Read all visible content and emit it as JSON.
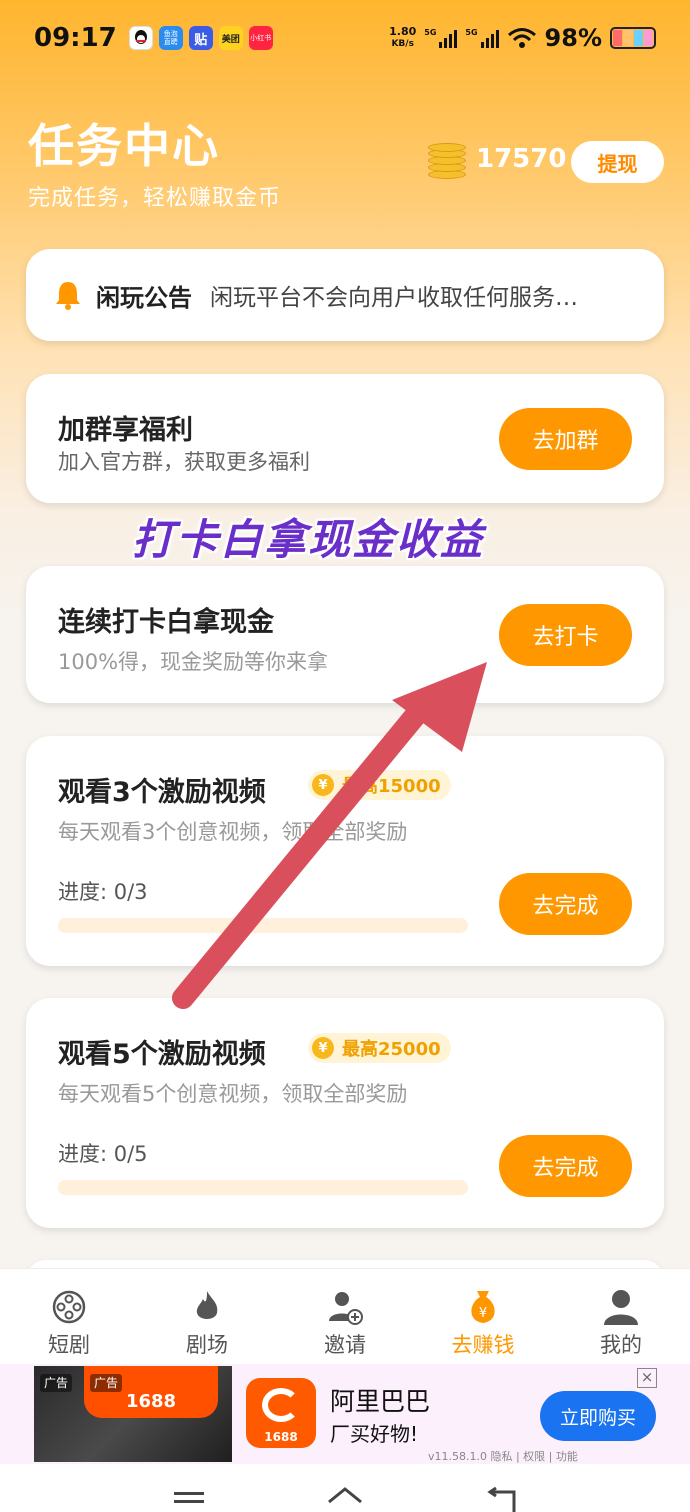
{
  "status_bar": {
    "time": "09:17",
    "app_icons": [
      {
        "name": "qq-icon",
        "label": "QQ",
        "color": "#ffffff"
      },
      {
        "name": "douyu-icon",
        "label": "鱼泡直聘",
        "color": "#2a8cf0"
      },
      {
        "name": "tieba-icon",
        "label": "贴",
        "color": "#3c5ce6"
      },
      {
        "name": "meituan-icon",
        "label": "美团",
        "color": "#ffd21f"
      },
      {
        "name": "xiaohongshu-icon",
        "label": "小红书",
        "color": "#ff2442"
      }
    ],
    "net_speed_value": "1.80",
    "net_speed_unit": "KB/s",
    "signal1_label": "5G",
    "signal2_label": "5G",
    "battery_percent": "98%"
  },
  "header": {
    "title": "任务中心",
    "subtitle": "完成任务，轻松赚取金币",
    "coin_count": "17570",
    "withdraw_label": "提现"
  },
  "notice": {
    "title": "闲玩公告",
    "text": "闲玩平台不会向用户收取任何服务…"
  },
  "tasks": [
    {
      "title": "加群享福利",
      "subtitle": "加入官方群，获取更多福利",
      "button": "去加群"
    },
    {
      "title": "连续打卡白拿现金",
      "subtitle": "100%得，现金奖励等你来拿",
      "button": "去打卡"
    },
    {
      "title": "观看3个激励视频",
      "badge": "最高15000",
      "subtitle": "每天观看3个创意视频，领取全部奖励",
      "progress_label": "进度: 0/3",
      "progress": 0,
      "button": "去完成"
    },
    {
      "title": "观看5个激励视频",
      "badge": "最高25000",
      "subtitle": "每天观看5个创意视频，领取全部奖励",
      "progress_label": "进度: 0/5",
      "progress": 0,
      "button": "去完成"
    }
  ],
  "promo_overlay": "打卡白拿现金收益",
  "accent_color": "#ff9800",
  "bottom_nav": [
    {
      "label": "短剧",
      "icon": "film-reel-icon",
      "active": false
    },
    {
      "label": "剧场",
      "icon": "fire-icon",
      "active": false
    },
    {
      "label": "邀请",
      "icon": "add-user-icon",
      "active": false
    },
    {
      "label": "去赚钱",
      "icon": "money-bag-icon",
      "active": true
    },
    {
      "label": "我的",
      "icon": "profile-icon",
      "active": false
    }
  ],
  "ad": {
    "tag1": "广告",
    "tag2": "广告",
    "image_brand": "1688",
    "logo_text": "1688",
    "name": "阿里巴巴",
    "slogan": "厂买好物!",
    "meta": "v11.58.1.0  隐私 | 权限 | 功能",
    "cta": "立即购买",
    "close": "×"
  }
}
